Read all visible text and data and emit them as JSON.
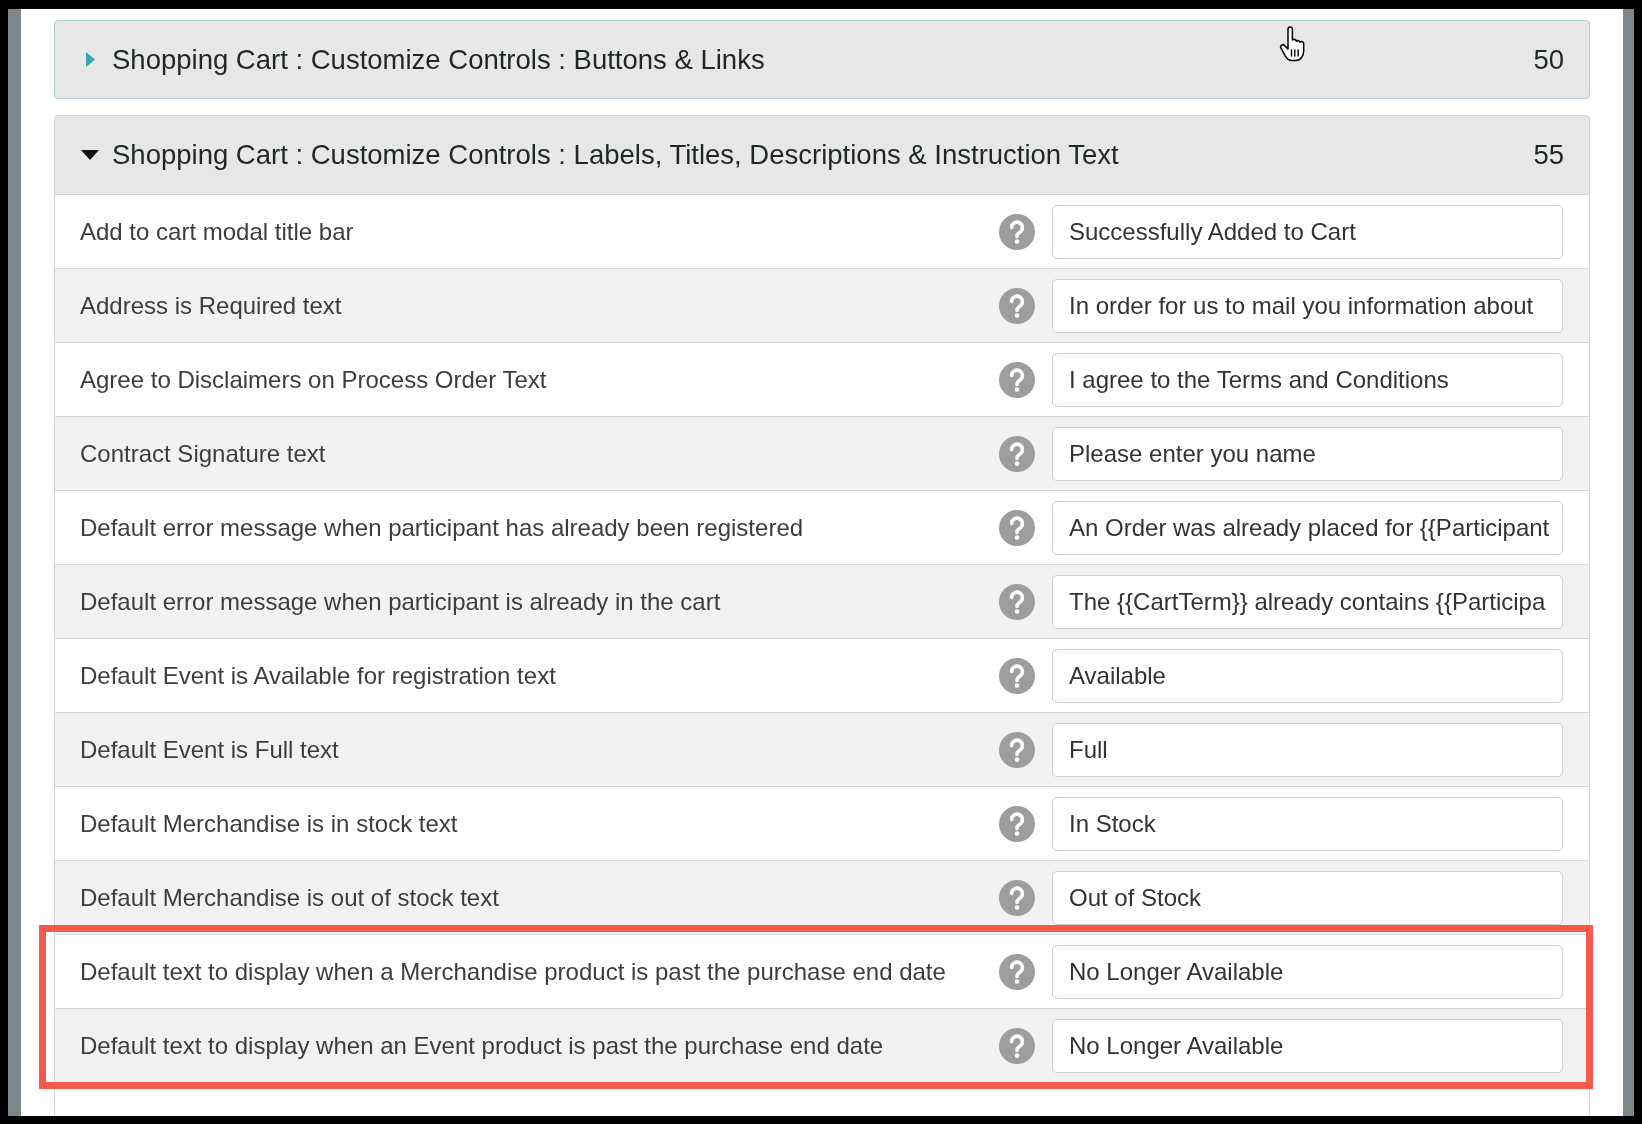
{
  "sections": [
    {
      "title": "Shopping Cart : Customize Controls : Buttons & Links",
      "count": "50",
      "expanded": false
    },
    {
      "title": "Shopping Cart : Customize Controls : Labels, Titles, Descriptions & Instruction Text",
      "count": "55",
      "expanded": true,
      "rows": [
        {
          "label": "Add to cart modal title bar",
          "value": "Successfully Added to Cart",
          "highlighted": false
        },
        {
          "label": "Address is Required text",
          "value": "In order for us to mail you information about",
          "highlighted": false
        },
        {
          "label": "Agree to Disclaimers on Process Order Text",
          "value": "I agree to the Terms and Conditions",
          "highlighted": false
        },
        {
          "label": "Contract Signature text",
          "value": "Please enter you name",
          "highlighted": false
        },
        {
          "label": "Default error message when participant has already been registered",
          "value": "An Order was already placed for {{Participant",
          "highlighted": false
        },
        {
          "label": "Default error message when participant is already in the cart",
          "value": "The {{CartTerm}} already contains {{Participa",
          "highlighted": false
        },
        {
          "label": "Default Event is Available for registration text",
          "value": "Available",
          "highlighted": false
        },
        {
          "label": "Default Event is Full text",
          "value": "Full",
          "highlighted": false
        },
        {
          "label": "Default Merchandise is in stock text",
          "value": "In Stock",
          "highlighted": false
        },
        {
          "label": "Default Merchandise is out of stock text",
          "value": "Out of Stock",
          "highlighted": false
        },
        {
          "label": "Default text to display when a Merchandise product is past the purchase end date",
          "value": "No Longer Available",
          "highlighted": true
        },
        {
          "label": "Default text to display when an Event product is past the purchase end date",
          "value": "No Longer Available",
          "highlighted": true
        }
      ]
    }
  ]
}
